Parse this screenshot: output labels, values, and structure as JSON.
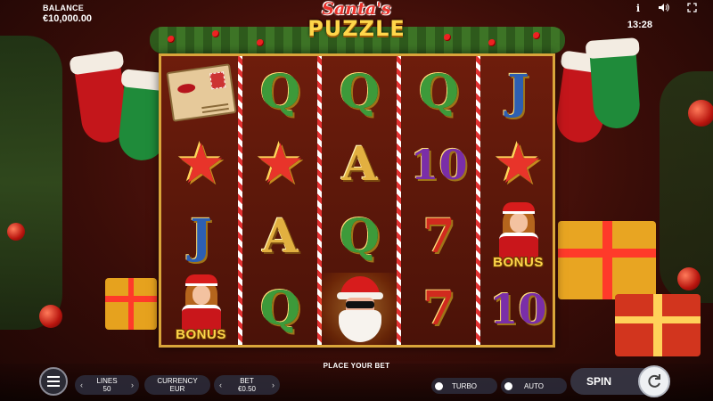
{
  "header": {
    "title": "Santa's Puzzle",
    "logo_top": "Santa's",
    "logo_main": "PUZZLE",
    "balance_label": "BALANCE",
    "balance_value": "€10,000.00",
    "clock": "13:28",
    "icons": [
      "info-icon",
      "sound-icon",
      "fullscreen-icon"
    ]
  },
  "reels": [
    [
      "letter",
      "star",
      "J",
      "bonus"
    ],
    [
      "Q",
      "star",
      "A",
      "Q"
    ],
    [
      "Q",
      "A",
      "Q",
      "santa"
    ],
    [
      "Q",
      "10",
      "7",
      "7"
    ],
    [
      "J",
      "star",
      "bonus",
      "10"
    ]
  ],
  "bonus_label": "BONUS",
  "bottom_bar": {
    "status": "PLACE YOUR BET",
    "lines_label": "LINES",
    "lines_value": "50",
    "currency_label": "CURRENCY",
    "currency_value": "EUR",
    "bet_label": "BET",
    "bet_value": "€0.50",
    "turbo_label": "TURBO",
    "auto_label": "AUTO",
    "spin_label": "SPIN"
  },
  "colors": {
    "frame_gold": "#d9a53a",
    "accent_red": "#d71c1c",
    "bonus_yellow": "#ffd54a"
  }
}
